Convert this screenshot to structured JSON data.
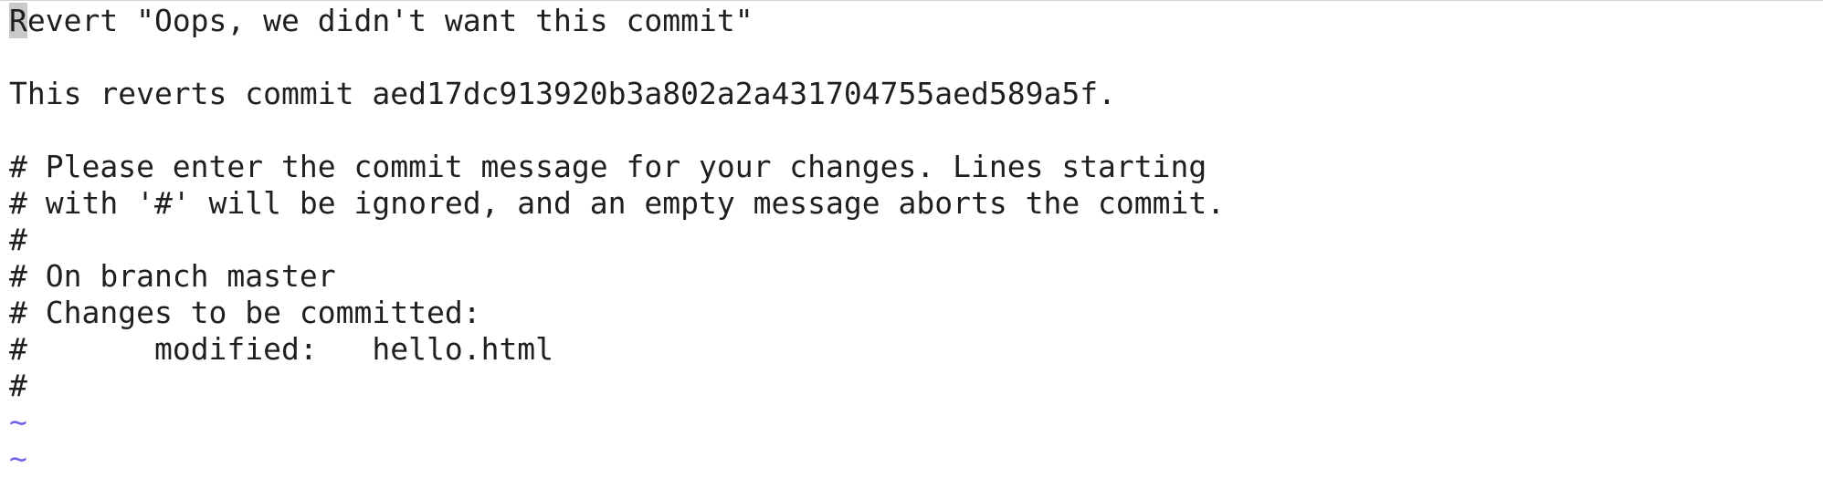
{
  "commit_editor": {
    "cursor_char": "R",
    "first_line_rest": "evert \"Oops, we didn't want this commit\"",
    "lines": [
      "",
      "This reverts commit aed17dc913920b3a802a2a431704755aed589a5f.",
      "",
      "# Please enter the commit message for your changes. Lines starting",
      "# with '#' will be ignored, and an empty message aborts the commit.",
      "#",
      "# On branch master",
      "# Changes to be committed:",
      "#\tmodified:   hello.html",
      "#"
    ],
    "empty_line_marker": "~"
  }
}
